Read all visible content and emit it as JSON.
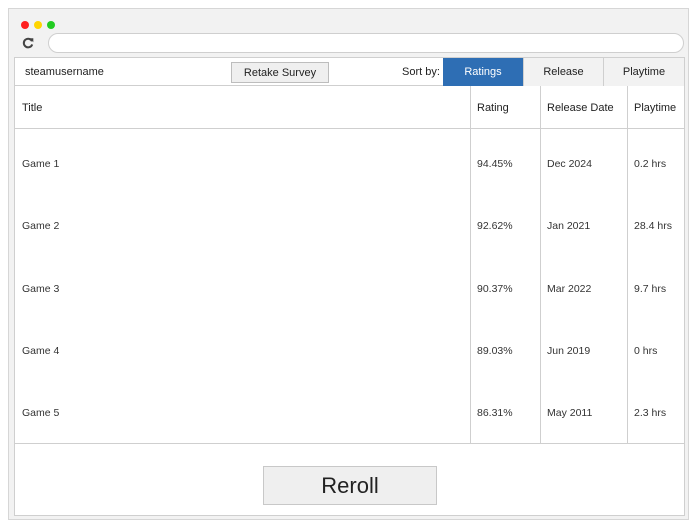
{
  "toolbar": {
    "username": "steamusername",
    "retake_label": "Retake Survey",
    "sort_label": "Sort by:",
    "sort_options": [
      "Ratings",
      "Release",
      "Playtime"
    ],
    "active_sort": "Ratings",
    "accent_color": "#2e6eb4"
  },
  "table": {
    "headers": [
      "Title",
      "Rating",
      "Release Date",
      "Playtime"
    ],
    "rows": [
      {
        "title": "Game 1",
        "rating": "94.45%",
        "release": "Dec 2024",
        "playtime": "0.2 hrs"
      },
      {
        "title": "Game 2",
        "rating": "92.62%",
        "release": "Jan 2021",
        "playtime": "28.4 hrs"
      },
      {
        "title": "Game 3",
        "rating": "90.37%",
        "release": "Mar 2022",
        "playtime": "9.7 hrs"
      },
      {
        "title": "Game 4",
        "rating": "89.03%",
        "release": "Jun 2019",
        "playtime": "0 hrs"
      },
      {
        "title": "Game 5",
        "rating": "86.31%",
        "release": "May 2011",
        "playtime": "2.3 hrs"
      }
    ]
  },
  "footer": {
    "reroll_label": "Reroll"
  },
  "icons": {
    "reload": "reload-icon"
  }
}
